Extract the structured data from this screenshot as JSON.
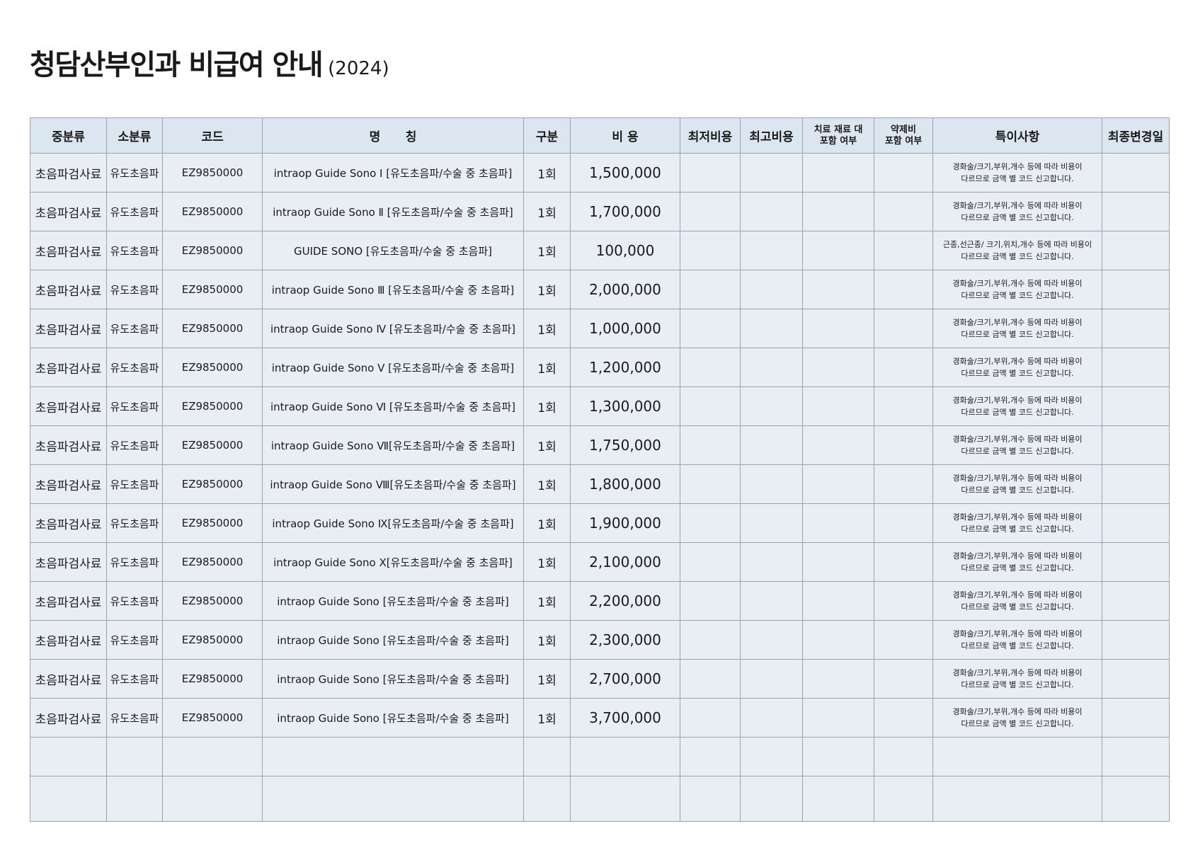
{
  "title": {
    "main": "청담산부인과 비급여 안내",
    "year": "(2024)"
  },
  "headers": {
    "mid_category": "중분류",
    "sub_category": "소분류",
    "code": "코드",
    "name": "명      칭",
    "unit": "구분",
    "cost": "비 용",
    "min_cost": "최저비용",
    "max_cost": "최고비용",
    "treatment_material_line1": "치료 재료 대",
    "treatment_material_line2": "포함 여부",
    "drug_line1": "약제비",
    "drug_line2": "포함 여부",
    "notes": "특이사항",
    "last_modified": "최종변경일"
  },
  "rows": [
    {
      "mid": "초음파검사료",
      "sub": "유도초음파",
      "code": "EZ9850000",
      "name": "intraop Guide Sono Ⅰ [유도초음파/수술 중 초음파]",
      "unit": "1회",
      "cost": "1,500,000",
      "note1": "경화술/크기,부위,개수 등에 따라 비용이",
      "note2": "다르므로 금액 별 코드 신고합니다."
    },
    {
      "mid": "초음파검사료",
      "sub": "유도초음파",
      "code": "EZ9850000",
      "name": "intraop Guide Sono Ⅱ [유도초음파/수술 중 초음파]",
      "unit": "1회",
      "cost": "1,700,000",
      "note1": "경화술/크기,부위,개수 등에 따라 비용이",
      "note2": "다르므로 금액 별 코드 신고합니다."
    },
    {
      "mid": "초음파검사료",
      "sub": "유도초음파",
      "code": "EZ9850000",
      "name": "GUIDE SONO [유도초음파/수술 중 초음파]",
      "unit": "1회",
      "cost": "100,000",
      "note1": "근종,선근종/ 크기,위치,개수 등에 따라 비용이",
      "note2": "다르므로 금액 별 코드 신고합니다."
    },
    {
      "mid": "초음파검사료",
      "sub": "유도초음파",
      "code": "EZ9850000",
      "name": "intraop Guide Sono Ⅲ [유도초음파/수술 중 초음파]",
      "unit": "1회",
      "cost": "2,000,000",
      "note1": "경화술/크기,부위,개수 등에 따라 비용이",
      "note2": "다르므로 금액 별 코드 신고합니다."
    },
    {
      "mid": "초음파검사료",
      "sub": "유도초음파",
      "code": "EZ9850000",
      "name": "intraop Guide Sono Ⅳ [유도초음파/수술 중 초음파]",
      "unit": "1회",
      "cost": "1,000,000",
      "note1": "경화술/크기,부위,개수 등에 따라 비용이",
      "note2": "다르므로 금액 별 코드 신고합니다."
    },
    {
      "mid": "초음파검사료",
      "sub": "유도초음파",
      "code": "EZ9850000",
      "name": "intraop Guide Sono Ⅴ [유도초음파/수술 중 초음파]",
      "unit": "1회",
      "cost": "1,200,000",
      "note1": "경화술/크기,부위,개수 등에 따라 비용이",
      "note2": "다르므로 금액 별 코드 신고합니다."
    },
    {
      "mid": "초음파검사료",
      "sub": "유도초음파",
      "code": "EZ9850000",
      "name": "intraop Guide Sono Ⅵ [유도초음파/수술 중 초음파]",
      "unit": "1회",
      "cost": "1,300,000",
      "note1": "경화술/크기,부위,개수 등에 따라 비용이",
      "note2": "다르므로 금액 별 코드 신고합니다."
    },
    {
      "mid": "초음파검사료",
      "sub": "유도초음파",
      "code": "EZ9850000",
      "name": "intraop Guide Sono Ⅶ[유도초음파/수술 중 초음파]",
      "unit": "1회",
      "cost": "1,750,000",
      "note1": "경화술/크기,부위,개수 등에 따라 비용이",
      "note2": "다르므로 금액 별 코드 신고합니다."
    },
    {
      "mid": "초음파검사료",
      "sub": "유도초음파",
      "code": "EZ9850000",
      "name": "intraop Guide Sono Ⅷ[유도초음파/수술 중 초음파]",
      "unit": "1회",
      "cost": "1,800,000",
      "note1": "경화술/크기,부위,개수 등에 따라 비용이",
      "note2": "다르므로 금액 별 코드 신고합니다."
    },
    {
      "mid": "초음파검사료",
      "sub": "유도초음파",
      "code": "EZ9850000",
      "name": "intraop Guide Sono Ⅸ[유도초음파/수술 중 초음파]",
      "unit": "1회",
      "cost": "1,900,000",
      "note1": "경화술/크기,부위,개수 등에 따라 비용이",
      "note2": "다르므로 금액 별 코드 신고합니다."
    },
    {
      "mid": "초음파검사료",
      "sub": "유도초음파",
      "code": "EZ9850000",
      "name": "intraop Guide Sono Ⅹ[유도초음파/수술 중 초음파]",
      "unit": "1회",
      "cost": "2,100,000",
      "note1": "경화술/크기,부위,개수 등에 따라 비용이",
      "note2": "다르므로 금액 별 코드 신고합니다."
    },
    {
      "mid": "초음파검사료",
      "sub": "유도초음파",
      "code": "EZ9850000",
      "name": "intraop Guide Sono [유도초음파/수술 중 초음파]",
      "unit": "1회",
      "cost": "2,200,000",
      "note1": "경화술/크기,부위,개수 등에 따라 비용이",
      "note2": "다르므로 금액 별 코드 신고합니다."
    },
    {
      "mid": "초음파검사료",
      "sub": "유도초음파",
      "code": "EZ9850000",
      "name": "intraop Guide Sono [유도초음파/수술 중 초음파]",
      "unit": "1회",
      "cost": "2,300,000",
      "note1": "경화술/크기,부위,개수 등에 따라 비용이",
      "note2": "다르므로 금액 별 코드 신고합니다."
    },
    {
      "mid": "초음파검사료",
      "sub": "유도초음파",
      "code": "EZ9850000",
      "name": "intraop Guide Sono [유도초음파/수술 중 초음파]",
      "unit": "1회",
      "cost": "2,700,000",
      "note1": "경화술/크기,부위,개수 등에 따라 비용이",
      "note2": "다르므로 금액 별 코드 신고합니다."
    },
    {
      "mid": "초음파검사료",
      "sub": "유도초음파",
      "code": "EZ9850000",
      "name": "intraop Guide Sono [유도초음파/수술 중 초음파]",
      "unit": "1회",
      "cost": "3,700,000",
      "note1": "경화술/크기,부위,개수 등에 따라 비용이",
      "note2": "다르므로 금액 별 코드 신고합니다."
    }
  ]
}
